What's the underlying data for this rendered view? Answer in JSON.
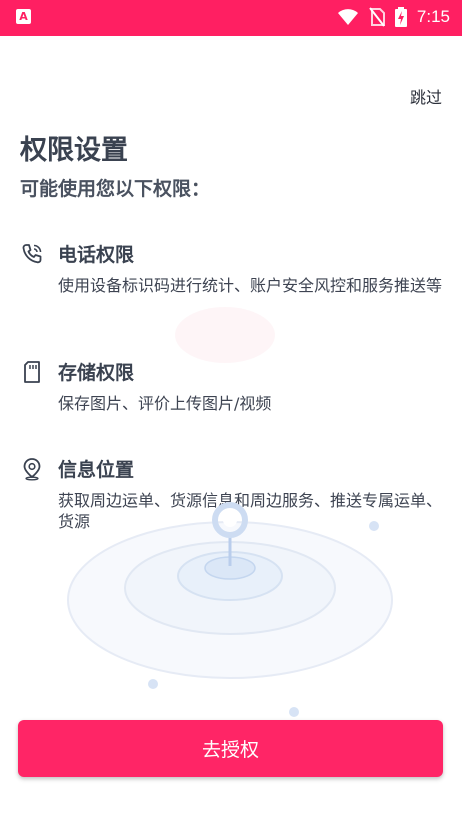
{
  "status_bar": {
    "time": "7:15",
    "left_badge": "A",
    "icons": [
      "wifi-icon",
      "no-sim-icon",
      "battery-charging-icon"
    ]
  },
  "header": {
    "skip_label": "跳过",
    "title": "权限设置",
    "subtitle": "可能使用您以下权限："
  },
  "permissions": [
    {
      "icon": "phone-icon",
      "title": "电话权限",
      "desc": "使用设备标识码进行统计、账户安全风控和服务推送等"
    },
    {
      "icon": "sd-card-icon",
      "title": "存储权限",
      "desc": "保存图片、评价上传图片/视频"
    },
    {
      "icon": "location-pin-icon",
      "title": "信息位置",
      "desc": "获取周边运单、货源信息和周边服务、推送专属运单、货源"
    }
  ],
  "action": {
    "authorize_label": "去授权"
  },
  "colors": {
    "accent": "#ff2566",
    "status_bar": "#ff1f62",
    "text": "#3a4250"
  }
}
